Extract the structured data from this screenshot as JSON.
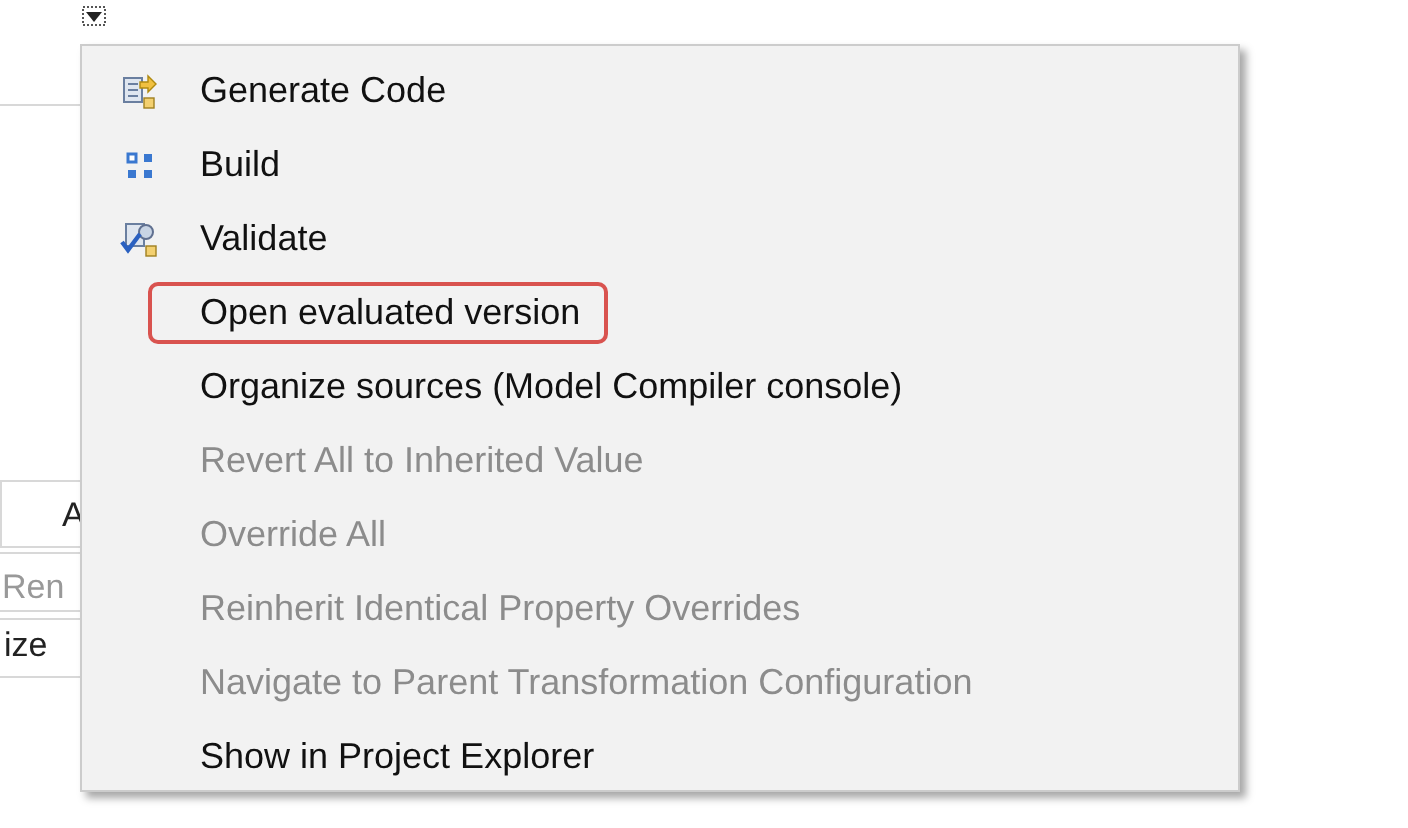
{
  "background_panel": {
    "cells": [
      "A",
      "Ren",
      "ize"
    ]
  },
  "context_menu": {
    "items": [
      {
        "label": "Generate Code",
        "kind": "code",
        "disabled": false,
        "highlighted": false
      },
      {
        "label": "Build",
        "kind": "build",
        "disabled": false,
        "highlighted": false
      },
      {
        "label": "Validate",
        "kind": "validate",
        "disabled": false,
        "highlighted": false
      },
      {
        "label": "Open evaluated version",
        "kind": "plain",
        "disabled": false,
        "highlighted": true
      },
      {
        "label": "Organize sources (Model Compiler console)",
        "kind": "plain",
        "disabled": false,
        "highlighted": false
      },
      {
        "label": "Revert All to Inherited Value",
        "kind": "plain",
        "disabled": true,
        "highlighted": false
      },
      {
        "label": "Override All",
        "kind": "plain",
        "disabled": true,
        "highlighted": false
      },
      {
        "label": "Reinherit Identical Property Overrides",
        "kind": "plain",
        "disabled": true,
        "highlighted": false
      },
      {
        "label": "Navigate to Parent Transformation Configuration",
        "kind": "plain",
        "disabled": true,
        "highlighted": false
      },
      {
        "label": "Show in Project Explorer",
        "kind": "plain",
        "disabled": false,
        "highlighted": false
      }
    ]
  }
}
